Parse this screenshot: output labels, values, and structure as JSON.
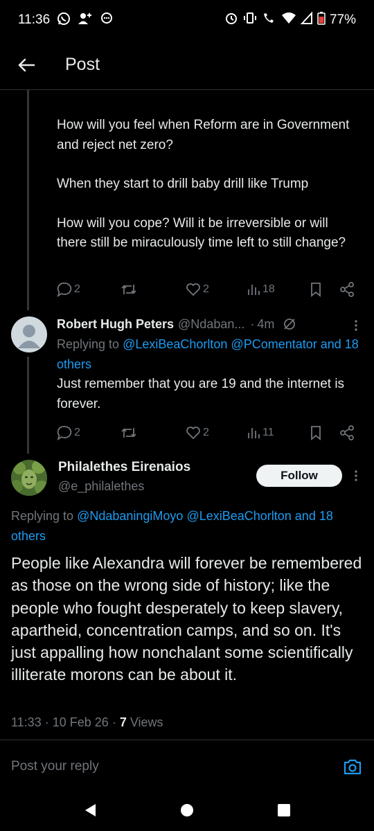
{
  "status_bar": {
    "time": "11:36",
    "battery": "77%",
    "left_icons": [
      "whatsapp-icon",
      "add-contact-icon",
      "chat-icon"
    ],
    "right_icons": [
      "alarm-icon",
      "vibrate-icon",
      "wifi-call-icon",
      "wifi-icon",
      "signal-icon",
      "battery-icon"
    ]
  },
  "header": {
    "title": "Post"
  },
  "reply1": {
    "paragraphs": [
      "How will you feel when Reform are in Government and reject net zero?",
      "When they start to drill baby drill like Trump",
      "How will you cope? Will it be irreversible or will there still be miraculously time left to still change?"
    ],
    "replies": "2",
    "likes": "2",
    "views": "18"
  },
  "reply2": {
    "name": "Robert Hugh Peters",
    "handle": "@Ndaban...",
    "time": "4m",
    "replying_prefix": "Replying to",
    "replying_mentions": "@LexiBeaChorlton @PComentator and 18 others",
    "body": "Just remember that you are 19 and the internet is forever.",
    "replies": "2",
    "likes": "2",
    "views": "11"
  },
  "main_post": {
    "name": "Philalethes Eirenaios",
    "handle": "@e_philalethes",
    "follow_label": "Follow",
    "replying_prefix": "Replying to",
    "replying_mentions": "@NdabaningiMoyo @LexiBeaChorlton and 18 others",
    "body": "People like Alexandra will forever be remembered as those on the wrong side of history; like the people who fought desperately to keep slavery, apartheid, concentration camps, and so on. It's just appalling how nonchalant some scientifically illiterate morons can be about it.",
    "time": "11:33",
    "date": "10 Feb 26",
    "views_count": "7",
    "views_label": "Views"
  },
  "reply_bar": {
    "placeholder": "Post your reply"
  },
  "colors": {
    "background": "#000000",
    "text": "#e7e9ea",
    "muted": "#71767b",
    "link": "#1d9bf0",
    "divider": "#2f3336"
  }
}
